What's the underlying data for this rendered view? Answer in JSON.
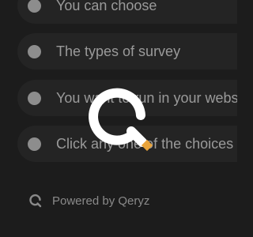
{
  "survey": {
    "choices": [
      {
        "label": "You can choose"
      },
      {
        "label": "The types of survey"
      },
      {
        "label": "You want to run in your webs"
      },
      {
        "label": "Click any one of the choices"
      }
    ]
  },
  "footer": {
    "powered_by": "Powered by Qeryz"
  },
  "colors": {
    "background": "#1c1c1c",
    "pill": "#242424",
    "radio": "#8d8d8d",
    "text": "#9a9a9a",
    "logo_ring": "#ffffff",
    "logo_accent": "#e8a33a"
  },
  "icons": {
    "logo": "qeryz-logo-icon",
    "footer": "qeryz-small-logo-icon"
  }
}
